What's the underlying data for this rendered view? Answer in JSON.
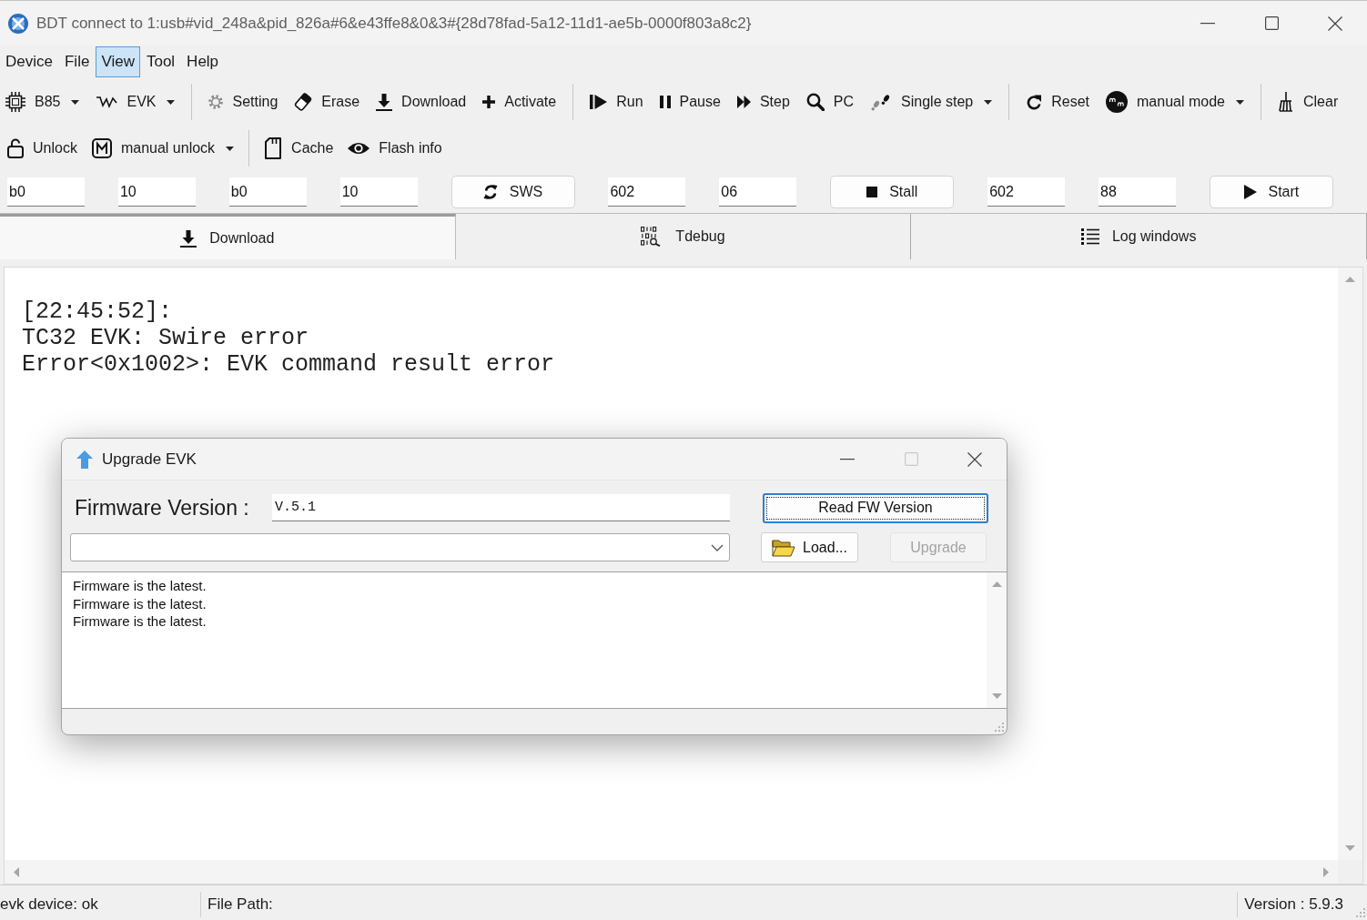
{
  "window": {
    "title": "BDT connect to 1:usb#vid_248a&pid_826a#6&e43ffe8&0&3#{28d78fad-5a12-11d1-ae5b-0000f803a8c2}"
  },
  "menu": [
    {
      "label": "Device",
      "selected": false
    },
    {
      "label": "File",
      "selected": false
    },
    {
      "label": "View",
      "selected": true
    },
    {
      "label": "Tool",
      "selected": false
    },
    {
      "label": "Help",
      "selected": false
    }
  ],
  "toolbars": [
    {
      "items": [
        {
          "kind": "dropdown",
          "label": "B85"
        },
        {
          "kind": "dropdown",
          "label": "EVK"
        },
        {
          "kind": "separator"
        },
        {
          "kind": "button",
          "label": "Setting"
        },
        {
          "kind": "button",
          "label": "Erase"
        },
        {
          "kind": "button",
          "label": "Download"
        },
        {
          "kind": "button",
          "label": "Activate"
        },
        {
          "kind": "separator"
        },
        {
          "kind": "button",
          "label": "Run"
        },
        {
          "kind": "button",
          "label": "Pause"
        },
        {
          "kind": "button",
          "label": "Step"
        },
        {
          "kind": "button",
          "label": "PC"
        },
        {
          "kind": "dropdown",
          "label": "Single step"
        },
        {
          "kind": "separator"
        },
        {
          "kind": "button",
          "label": "Reset"
        },
        {
          "kind": "dropdown",
          "label": "manual mode"
        },
        {
          "kind": "separator"
        },
        {
          "kind": "button",
          "label": "Clear"
        }
      ]
    },
    {
      "items": [
        {
          "kind": "button",
          "label": "Unlock"
        },
        {
          "kind": "dropdown",
          "label": "manual unlock"
        },
        {
          "kind": "separator"
        },
        {
          "kind": "button",
          "label": "Cache"
        },
        {
          "kind": "button",
          "label": "Flash info"
        }
      ]
    }
  ],
  "register_row": [
    {
      "kind": "field",
      "value": "b0"
    },
    {
      "kind": "field",
      "value": "10"
    },
    {
      "kind": "field",
      "value": "b0"
    },
    {
      "kind": "field",
      "value": "10"
    },
    {
      "kind": "button",
      "label": "SWS"
    },
    {
      "kind": "field",
      "value": "602"
    },
    {
      "kind": "field",
      "value": "06"
    },
    {
      "kind": "button",
      "label": "Stall"
    },
    {
      "kind": "field",
      "value": "602"
    },
    {
      "kind": "field",
      "value": "88"
    },
    {
      "kind": "button",
      "label": "Start"
    }
  ],
  "tabs": [
    {
      "label": "Download",
      "selected": true
    },
    {
      "label": "Tdebug",
      "selected": false
    },
    {
      "label": "Log windows",
      "selected": false
    }
  ],
  "log": {
    "lines": [
      "[22:45:52]:",
      "TC32 EVK: Swire error",
      "Error<0x1002>: EVK command result error"
    ]
  },
  "dialog": {
    "title": "Upgrade EVK",
    "maximize_disabled": true,
    "firmware_label": "Firmware Version :",
    "firmware_value": "V.5.1",
    "buttons": [
      {
        "label": "Read FW Version",
        "focused": true,
        "disabled": false
      },
      {
        "label": "Load...",
        "focused": false,
        "disabled": false
      },
      {
        "label": "Upgrade",
        "focused": false,
        "disabled": true
      }
    ],
    "messages": [
      "Firmware is the latest.",
      "Firmware is the latest.",
      "Firmware is the latest."
    ]
  },
  "status_bar": [
    "evk device: ok",
    "File Path:",
    "Version : 5.9.3"
  ]
}
